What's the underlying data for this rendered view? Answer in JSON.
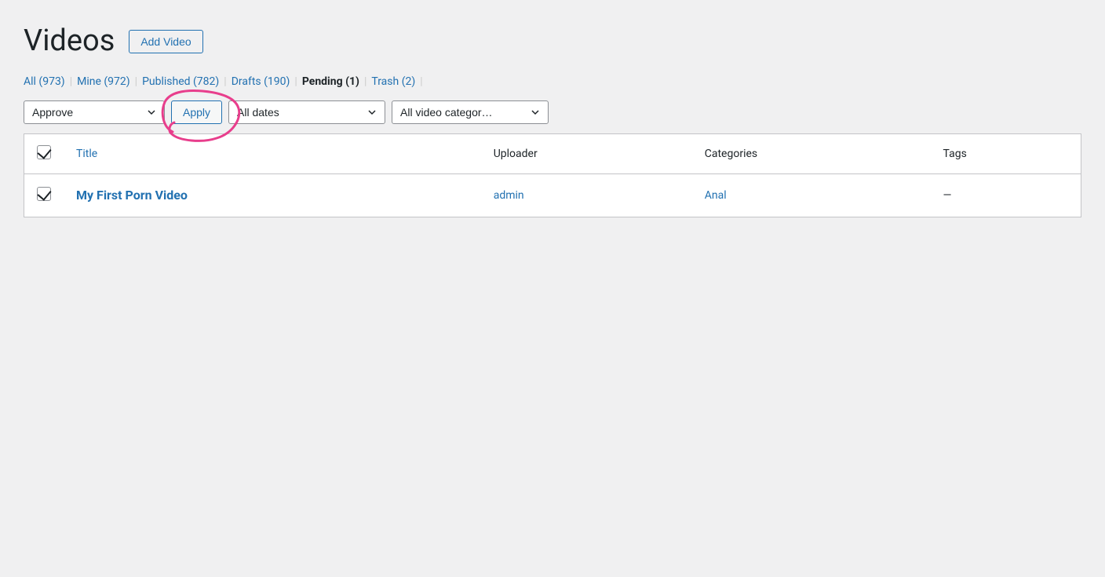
{
  "page": {
    "title": "Videos",
    "add_video_label": "Add Video"
  },
  "status_filters": [
    {
      "label": "All",
      "count": "973",
      "active": false
    },
    {
      "label": "Mine",
      "count": "972",
      "active": false
    },
    {
      "label": "Published",
      "count": "782",
      "active": false
    },
    {
      "label": "Drafts",
      "count": "190",
      "active": false
    },
    {
      "label": "Pending",
      "count": "1",
      "active": true
    },
    {
      "label": "Trash",
      "count": "2",
      "active": false
    }
  ],
  "toolbar": {
    "bulk_action_label": "Approve",
    "apply_label": "Apply",
    "date_filter_label": "All dates",
    "category_filter_label": "All video categor…"
  },
  "table": {
    "columns": [
      "",
      "Title",
      "Uploader",
      "Categories",
      "Tags"
    ],
    "rows": [
      {
        "checked": true,
        "title": "My First Porn Video",
        "uploader": "admin",
        "categories": "Anal",
        "tags": "—"
      }
    ]
  }
}
